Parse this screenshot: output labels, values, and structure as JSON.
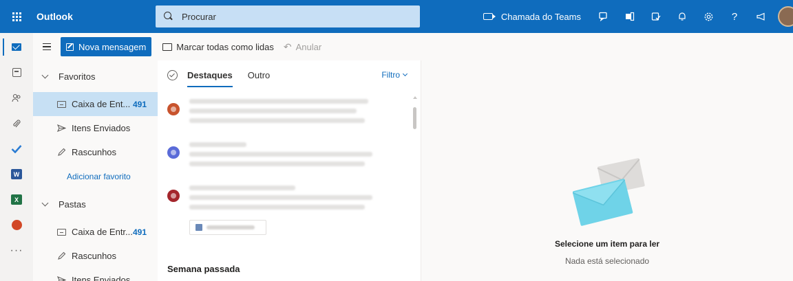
{
  "topbar": {
    "app_name": "Outlook",
    "search_placeholder": "Procurar",
    "teams_call": "Chamada do Teams",
    "help": "?",
    "color": "#0f6cbd"
  },
  "rail": {
    "icons": [
      "mail-icon",
      "calendar-icon",
      "people-icon",
      "attachment-icon",
      "todo-icon",
      "word-icon",
      "excel-icon",
      "powerpoint-icon",
      "more-apps-icon"
    ],
    "word_letter": "W",
    "excel_letter": "X",
    "more": "···"
  },
  "cmdbar": {
    "new_message": "Nova mensagem",
    "mark_all_read": "Marcar todas como lidas",
    "undo": "Anular"
  },
  "folders": {
    "favorites_label": "Favoritos",
    "favorites": [
      {
        "label": "Caixa de Ent...",
        "count": "491",
        "selected": true
      },
      {
        "label": "Itens Enviados",
        "count": ""
      },
      {
        "label": "Rascunhos",
        "count": ""
      }
    ],
    "add_favorite": "Adicionar favorito",
    "folders_label": "Pastas",
    "folders": [
      {
        "label": "Caixa de Entr...",
        "count": "491"
      },
      {
        "label": "Rascunhos",
        "count": ""
      },
      {
        "label": "Itens Enviados",
        "count": ""
      }
    ]
  },
  "messages": {
    "tab_focused": "Destaques",
    "tab_other": "Outro",
    "filter": "Filtro",
    "avatar_colors": [
      "#c8532d",
      "#5a6bd8",
      "#a4262c"
    ],
    "section_last_week": "Semana passada"
  },
  "reading": {
    "title": "Selecione um item para ler",
    "subtitle": "Nada está selecionado"
  }
}
